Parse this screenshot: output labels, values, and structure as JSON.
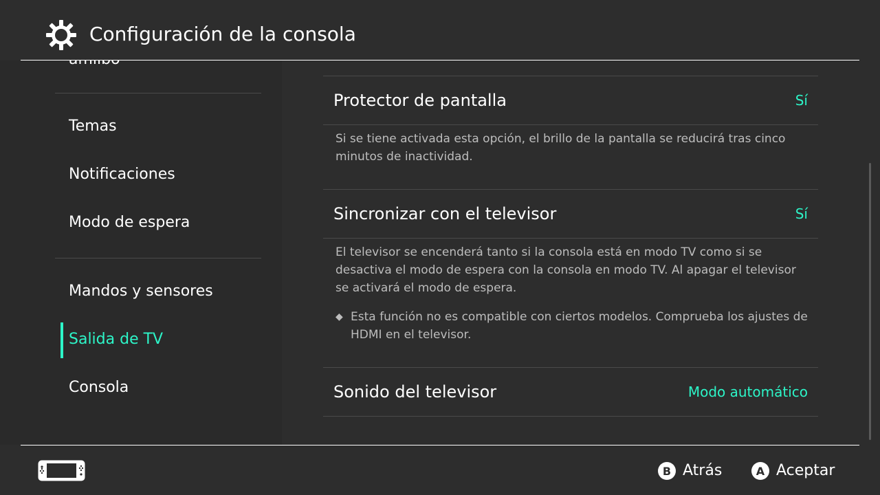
{
  "header": {
    "title": "Configuración de la consola",
    "icon": "gear-icon"
  },
  "sidebar": {
    "partial_item": "amiibo",
    "items": [
      {
        "label": "Temas"
      },
      {
        "label": "Notificaciones"
      },
      {
        "label": "Modo de espera"
      },
      {
        "label": "Mandos y sensores"
      },
      {
        "label": "Salida de TV",
        "active": true
      },
      {
        "label": "Consola"
      }
    ]
  },
  "main": {
    "rows": [
      {
        "label": "Protector de pantalla",
        "value": "Sí",
        "description": "Si se tiene activada esta opción, el brillo de la pantalla se reducirá tras cinco minutos de inactividad."
      },
      {
        "label": "Sincronizar con el televisor",
        "value": "Sí",
        "description": "El televisor se encenderá tanto si la consola está en modo TV como si se desactiva el modo de espera con la consola en modo TV. Al apagar el televisor se activará el modo de espera.",
        "note": "Esta función no es compatible con ciertos modelos. Comprueba los ajustes de HDMI en el televisor."
      },
      {
        "label": "Sonido del televisor",
        "value": "Modo automático"
      }
    ]
  },
  "footer": {
    "back": {
      "button": "B",
      "label": "Atrás"
    },
    "accept": {
      "button": "A",
      "label": "Aceptar"
    },
    "console_icon": "console-icon"
  },
  "colors": {
    "accent": "#2df5c8",
    "background": "#2d2d2d",
    "sidebar": "#2a2a2a",
    "text_secondary": "#bdbdbd"
  }
}
